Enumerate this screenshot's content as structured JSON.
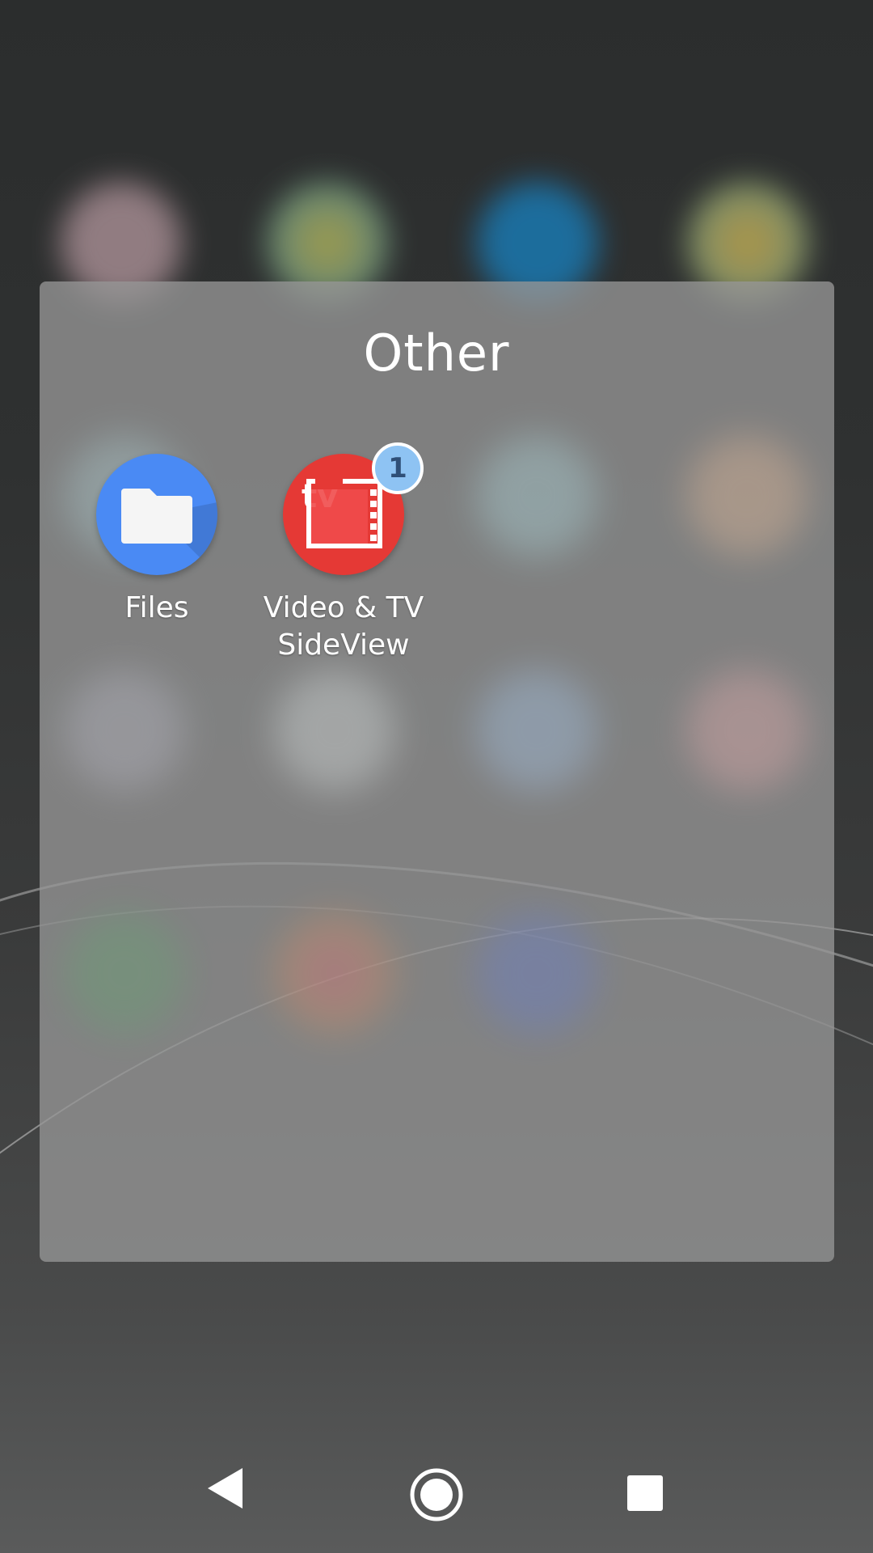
{
  "folder": {
    "title": "Other",
    "apps": [
      {
        "label": "Files",
        "icon": "files-folder-icon",
        "color": "#4a8af4"
      },
      {
        "label": "Video & TV\nSideView",
        "icon": "video-tv-sideview-icon",
        "color": "#e53935",
        "badge": "1"
      }
    ]
  },
  "navigation": {
    "back": "back-icon",
    "home": "home-icon",
    "recents": "recents-icon"
  },
  "colors": {
    "badge": "#8ec3f3",
    "files_blue": "#4a8af4",
    "sideview_red": "#e53935"
  }
}
